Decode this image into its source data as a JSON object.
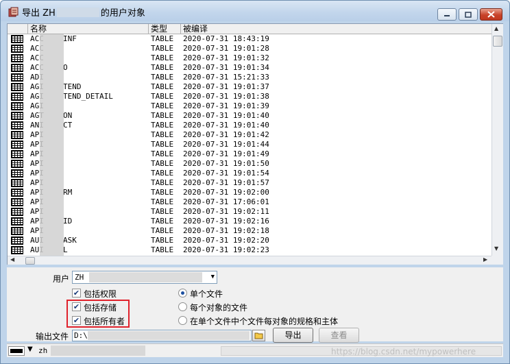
{
  "window": {
    "title_prefix": "导出 ZH",
    "title_suffix": "的用户对象"
  },
  "table": {
    "columns": [
      "名称",
      "类型",
      "被编译"
    ],
    "rows": [
      {
        "name": "ACC",
        "name_tail": "INF",
        "type": "TABLE",
        "compiled": "2020-07-31 18:43:19"
      },
      {
        "name": "ACC",
        "name_tail": "",
        "type": "TABLE",
        "compiled": "2020-07-31 19:01:28"
      },
      {
        "name": "ACC",
        "name_tail": "",
        "type": "TABLE",
        "compiled": "2020-07-31 19:01:32"
      },
      {
        "name": "ACC",
        "name_tail": "O",
        "type": "TABLE",
        "compiled": "2020-07-31 19:01:34"
      },
      {
        "name": "ADI",
        "name_tail": "",
        "type": "TABLE",
        "compiled": "2020-07-31 15:21:33"
      },
      {
        "name": "AGI",
        "name_tail": "TEND",
        "type": "TABLE",
        "compiled": "2020-07-31 19:01:37"
      },
      {
        "name": "AGI",
        "name_tail": "TEND_DETAIL",
        "type": "TABLE",
        "compiled": "2020-07-31 19:01:38"
      },
      {
        "name": "AGI",
        "name_tail": "",
        "type": "TABLE",
        "compiled": "2020-07-31 19:01:39"
      },
      {
        "name": "AGT",
        "name_tail": "ON",
        "type": "TABLE",
        "compiled": "2020-07-31 19:01:40"
      },
      {
        "name": "ANI",
        "name_tail": "CT",
        "type": "TABLE",
        "compiled": "2020-07-31 19:01:40"
      },
      {
        "name": "API",
        "name_tail": "",
        "type": "TABLE",
        "compiled": "2020-07-31 19:01:42"
      },
      {
        "name": "API",
        "name_tail": "",
        "type": "TABLE",
        "compiled": "2020-07-31 19:01:44"
      },
      {
        "name": "API",
        "name_tail": "",
        "type": "TABLE",
        "compiled": "2020-07-31 19:01:49"
      },
      {
        "name": "API",
        "name_tail": "",
        "type": "TABLE",
        "compiled": "2020-07-31 19:01:50"
      },
      {
        "name": "API",
        "name_tail": "",
        "type": "TABLE",
        "compiled": "2020-07-31 19:01:54"
      },
      {
        "name": "API",
        "name_tail": "",
        "type": "TABLE",
        "compiled": "2020-07-31 19:01:57"
      },
      {
        "name": "API",
        "name_tail": "RM",
        "type": "TABLE",
        "compiled": "2020-07-31 19:02:00"
      },
      {
        "name": "API",
        "name_tail": "",
        "type": "TABLE",
        "compiled": "2020-07-31 17:06:01"
      },
      {
        "name": "API",
        "name_tail": "",
        "type": "TABLE",
        "compiled": "2020-07-31 19:02:11"
      },
      {
        "name": "API",
        "name_tail": "ID",
        "type": "TABLE",
        "compiled": "2020-07-31 19:02:16"
      },
      {
        "name": "API",
        "name_tail": "",
        "type": "TABLE",
        "compiled": "2020-07-31 19:02:18"
      },
      {
        "name": "AUI",
        "name_tail": "ASK",
        "type": "TABLE",
        "compiled": "2020-07-31 19:02:20"
      },
      {
        "name": "AUI",
        "name_tail": "L",
        "type": "TABLE",
        "compiled": "2020-07-31 19:02:23"
      }
    ]
  },
  "options": {
    "user_label": "用户",
    "user_value": "ZH",
    "include_privileges": {
      "label": "包括权限",
      "checked": true
    },
    "include_storage": {
      "label": "包括存储",
      "checked": true
    },
    "include_owner": {
      "label": "包括所有者",
      "checked": true
    },
    "output_single_file": {
      "label": "单个文件",
      "selected": true
    },
    "output_file_per_object": {
      "label": "每个对象的文件",
      "selected": false
    },
    "output_spec_body": {
      "label": "在单个文件中个文件每对象的规格和主体",
      "selected": false
    },
    "output_file_label": "输出文件",
    "output_file_value": "D:\\"
  },
  "buttons": {
    "export": "导出",
    "view": "查看"
  },
  "status": {
    "connection": "zh"
  },
  "watermark": "https://blog.csdn.net/mypowerhere",
  "colors": {
    "title_bar": "#c3d6ec",
    "close_button": "#c8432a",
    "highlight_box": "#e0212b"
  }
}
